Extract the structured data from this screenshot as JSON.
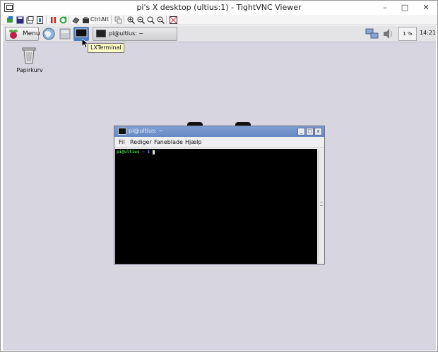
{
  "window": {
    "title": "pi's X desktop (ultius:1) - TightVNC Viewer",
    "minimize": "–",
    "maximize": "□",
    "close": "✕"
  },
  "vnc_toolbar": {
    "ctrl_label": "Ctrl",
    "alt_label": "Alt"
  },
  "panel": {
    "menu_label": "Menu",
    "task_label": "pi@ultius: ~",
    "cpu_label": "1 %",
    "clock": "14:21"
  },
  "tooltip": "LXTerminal",
  "desktop_icon": {
    "label": "Papirkurv"
  },
  "terminal": {
    "title": "pi@ultius: ~",
    "menu": [
      "Fil",
      "Rediger",
      "Faneblade",
      "Hjælp"
    ],
    "prompt_user": "pi@ultius",
    "prompt_path": " ~ $ "
  },
  "colors": {
    "desktop_bg": "#d6d5e0",
    "terminal_title_bg": "#7f9dd1",
    "prompt_user": "#3fd13f",
    "prompt_path": "#6b7bff"
  }
}
